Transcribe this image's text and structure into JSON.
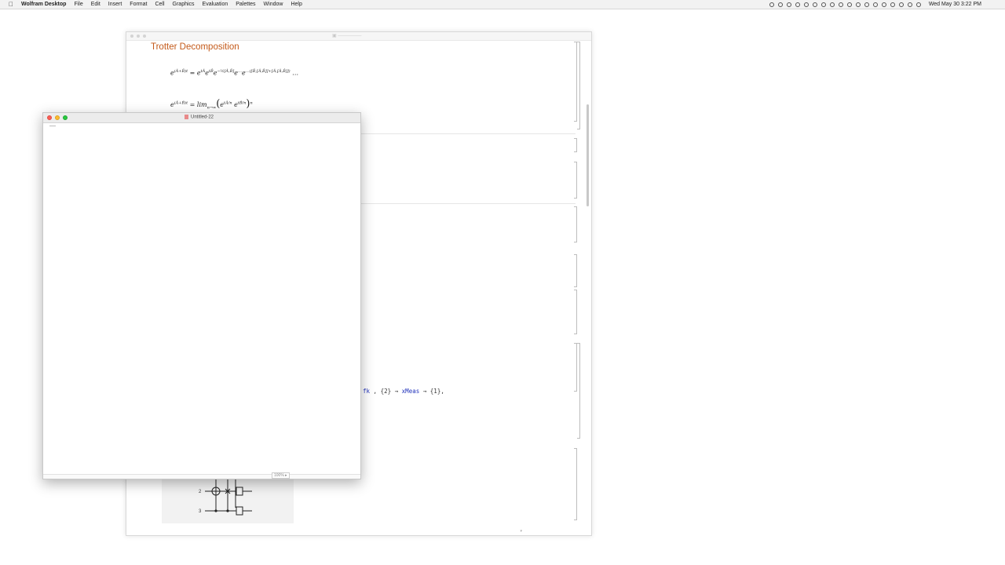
{
  "menubar": {
    "app_name": "Wolfram Desktop",
    "menus": [
      "File",
      "Edit",
      "Insert",
      "Format",
      "Cell",
      "Graphics",
      "Evaluation",
      "Palettes",
      "Window",
      "Help"
    ],
    "clock": "Wed May 30  3:22 PM"
  },
  "main_window": {
    "section_title": "Trotter Decomposition",
    "code_fragment": {
      "part1": "fk",
      "part2": " , {2} → ",
      "part3": "xMeas",
      "part4": " → {1},"
    },
    "circuit": {
      "row_labels": [
        "2",
        "3"
      ]
    }
  },
  "front_window": {
    "title": "Untitled-22",
    "zoom": "100%"
  }
}
